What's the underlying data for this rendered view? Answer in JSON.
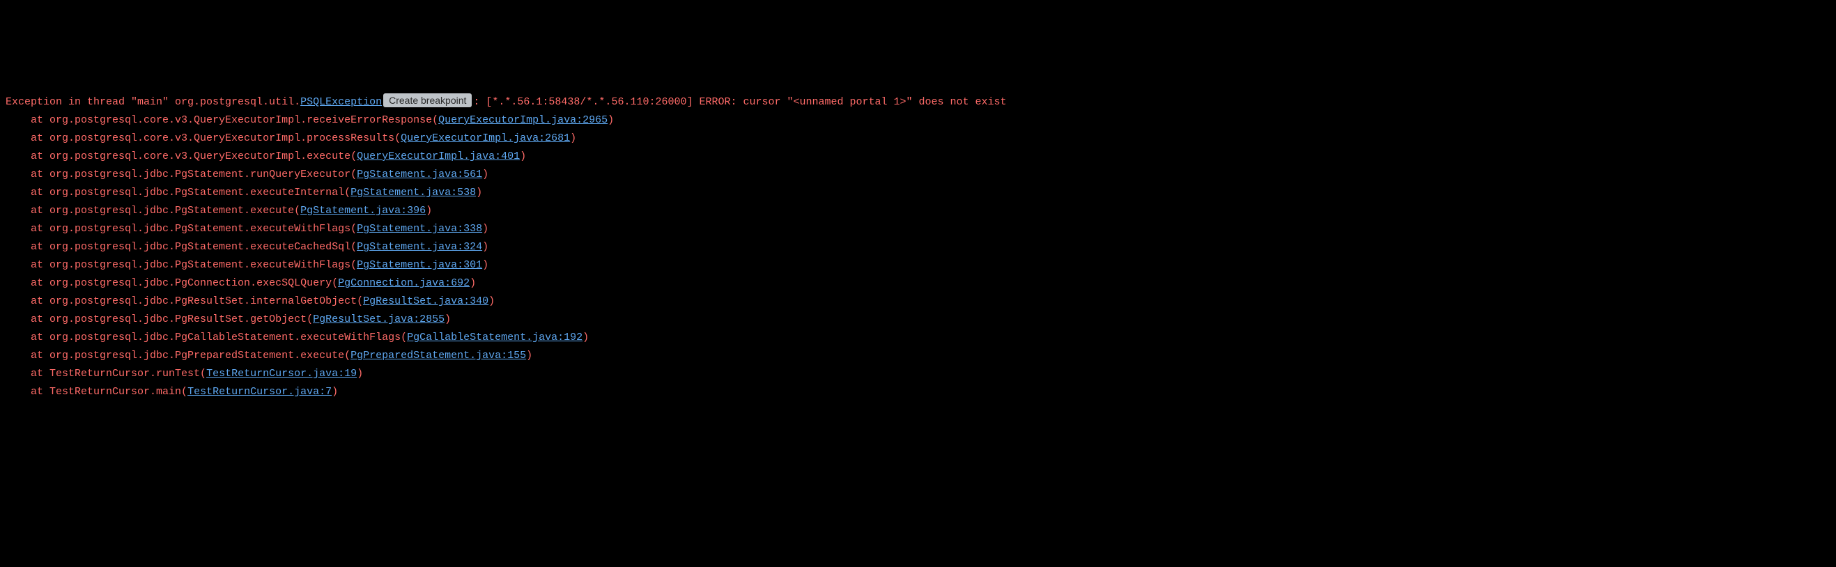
{
  "exception": {
    "prefix": "Exception in thread \"main\" org.postgresql.util.",
    "exception_link": "PSQLException",
    "breakpoint_label": "Create breakpoint",
    "after_breakpoint": ": [*.*.56.1:58438/*.*.56.110:26000] ERROR: cursor \"<unnamed portal 1>\" does not exist"
  },
  "frames": [
    {
      "indent": "    at ",
      "prefix": "org.postgresql.core.v3.QueryExecutorImpl.receiveErrorResponse(",
      "link": "QueryExecutorImpl.java:2965",
      "suffix": ")"
    },
    {
      "indent": "    at ",
      "prefix": "org.postgresql.core.v3.QueryExecutorImpl.processResults(",
      "link": "QueryExecutorImpl.java:2681",
      "suffix": ")"
    },
    {
      "indent": "    at ",
      "prefix": "org.postgresql.core.v3.QueryExecutorImpl.execute(",
      "link": "QueryExecutorImpl.java:401",
      "suffix": ")"
    },
    {
      "indent": "    at ",
      "prefix": "org.postgresql.jdbc.PgStatement.runQueryExecutor(",
      "link": "PgStatement.java:561",
      "suffix": ")"
    },
    {
      "indent": "    at ",
      "prefix": "org.postgresql.jdbc.PgStatement.executeInternal(",
      "link": "PgStatement.java:538",
      "suffix": ")"
    },
    {
      "indent": "    at ",
      "prefix": "org.postgresql.jdbc.PgStatement.execute(",
      "link": "PgStatement.java:396",
      "suffix": ")"
    },
    {
      "indent": "    at ",
      "prefix": "org.postgresql.jdbc.PgStatement.executeWithFlags(",
      "link": "PgStatement.java:338",
      "suffix": ")"
    },
    {
      "indent": "    at ",
      "prefix": "org.postgresql.jdbc.PgStatement.executeCachedSql(",
      "link": "PgStatement.java:324",
      "suffix": ")"
    },
    {
      "indent": "    at ",
      "prefix": "org.postgresql.jdbc.PgStatement.executeWithFlags(",
      "link": "PgStatement.java:301",
      "suffix": ")"
    },
    {
      "indent": "    at ",
      "prefix": "org.postgresql.jdbc.PgConnection.execSQLQuery(",
      "link": "PgConnection.java:692",
      "suffix": ")"
    },
    {
      "indent": "    at ",
      "prefix": "org.postgresql.jdbc.PgResultSet.internalGetObject(",
      "link": "PgResultSet.java:340",
      "suffix": ")"
    },
    {
      "indent": "    at ",
      "prefix": "org.postgresql.jdbc.PgResultSet.getObject(",
      "link": "PgResultSet.java:2855",
      "suffix": ")"
    },
    {
      "indent": "    at ",
      "prefix": "org.postgresql.jdbc.PgCallableStatement.executeWithFlags(",
      "link": "PgCallableStatement.java:192",
      "suffix": ")"
    },
    {
      "indent": "    at ",
      "prefix": "org.postgresql.jdbc.PgPreparedStatement.execute(",
      "link": "PgPreparedStatement.java:155",
      "suffix": ")"
    },
    {
      "indent": "    at ",
      "prefix": "TestReturnCursor.runTest(",
      "link": "TestReturnCursor.java:19",
      "suffix": ")"
    },
    {
      "indent": "    at ",
      "prefix": "TestReturnCursor.main(",
      "link": "TestReturnCursor.java:7",
      "suffix": ")"
    }
  ]
}
